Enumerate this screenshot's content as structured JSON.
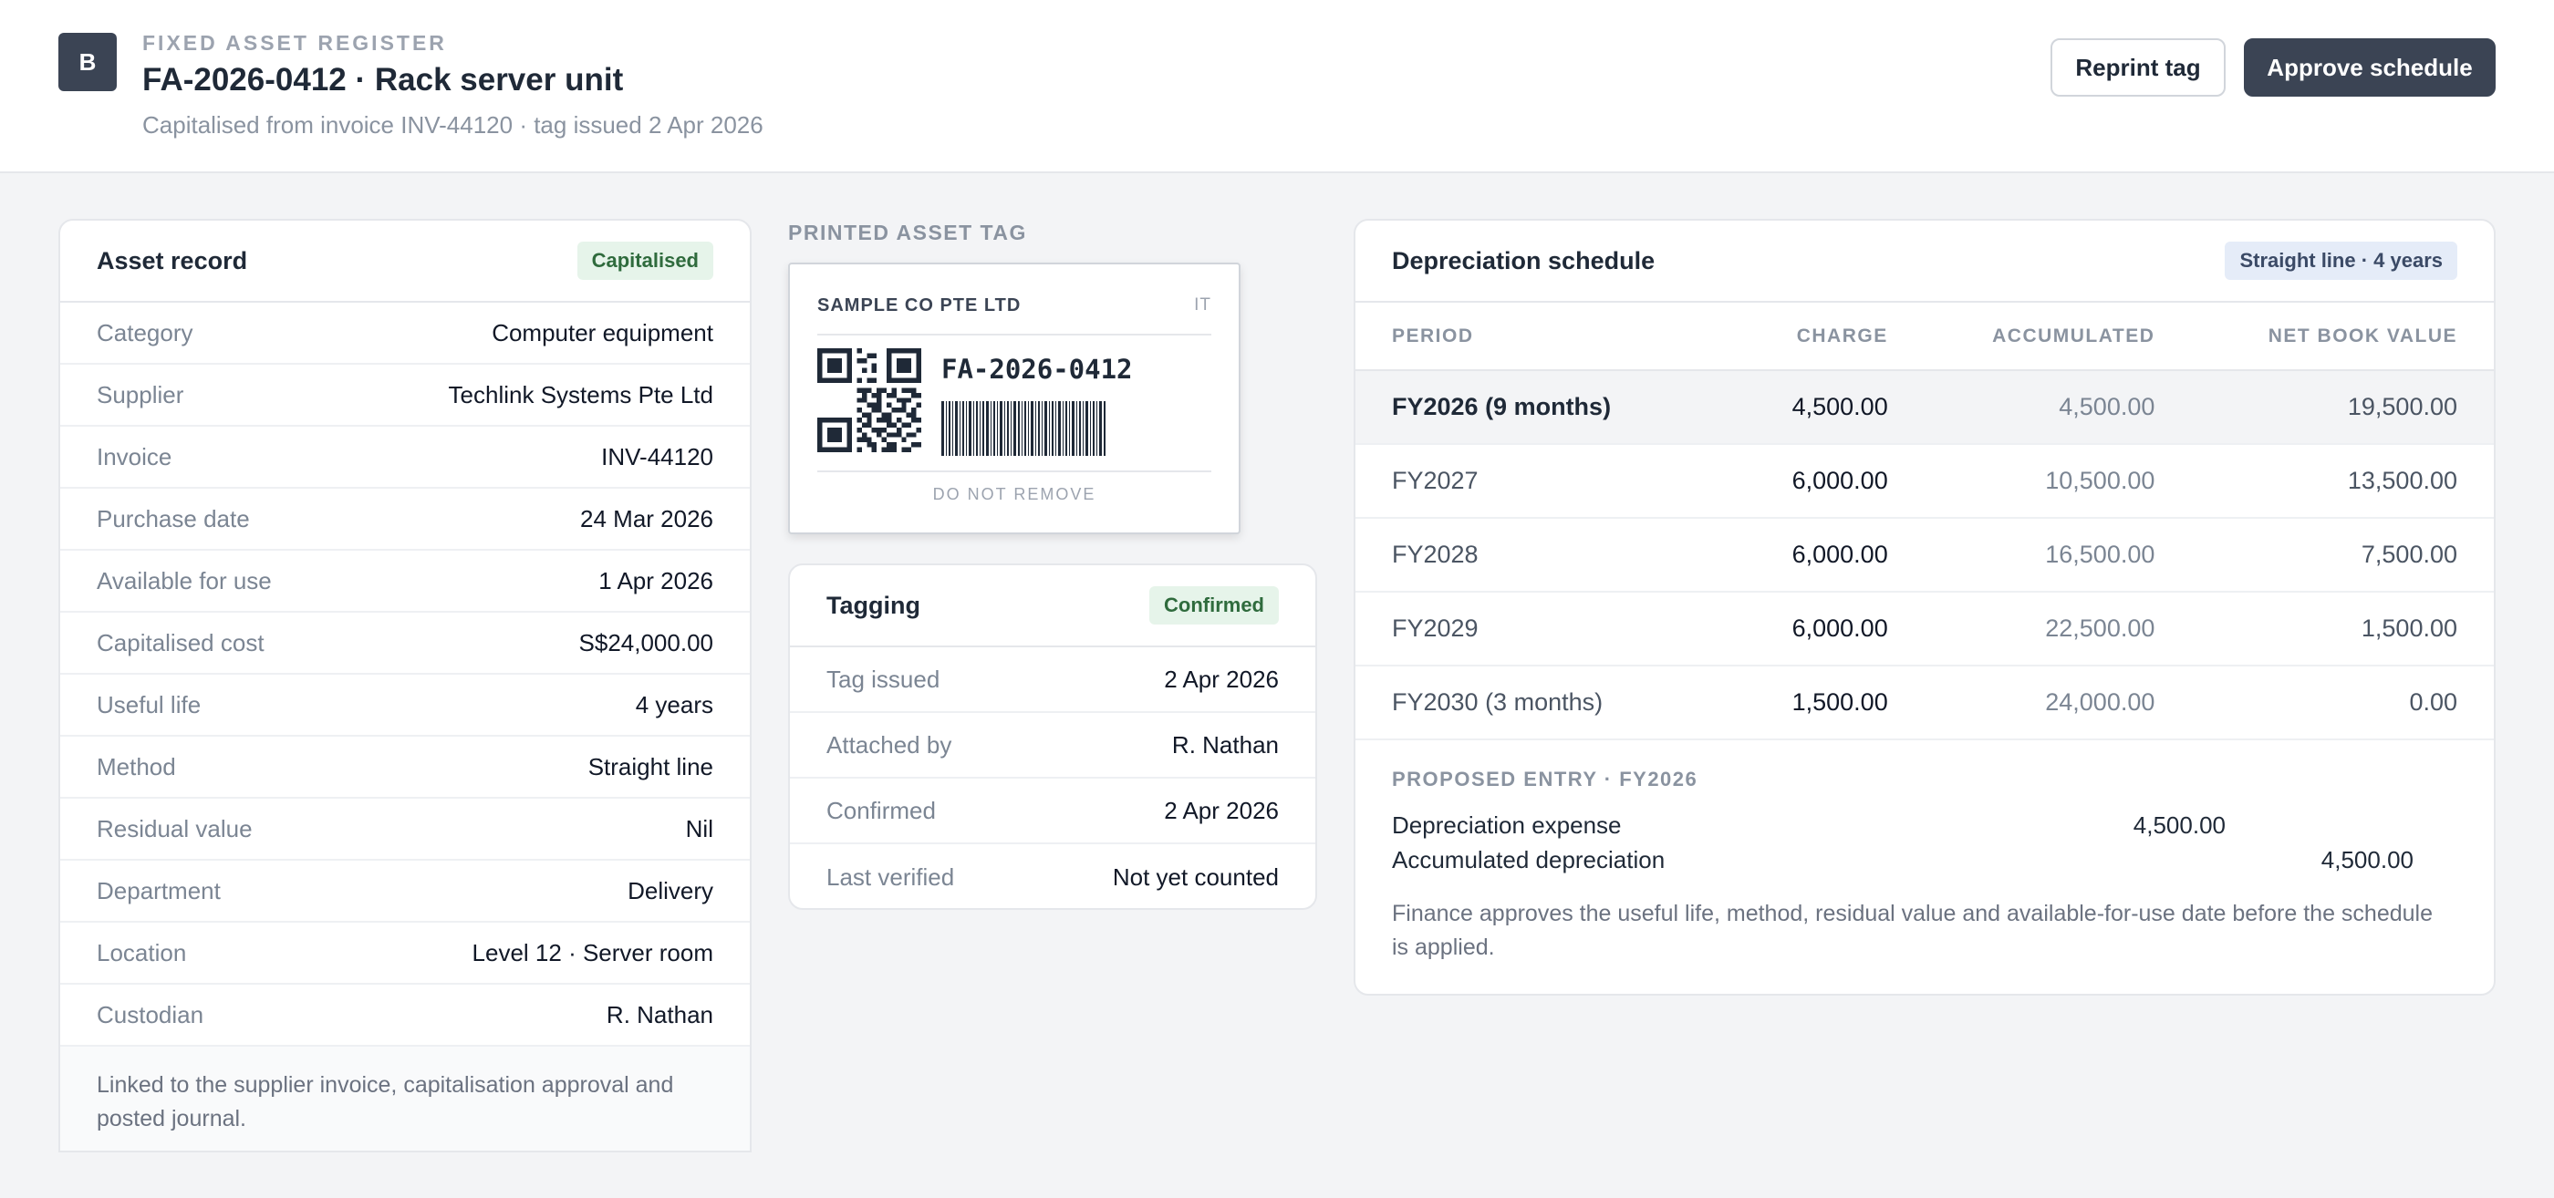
{
  "header": {
    "logo_letter": "B",
    "eyebrow": "FIXED ASSET REGISTER",
    "title": "FA-2026-0412 · Rack server unit",
    "subtitle": "Capitalised from invoice INV-44120 · tag issued 2 Apr 2026",
    "reprint_label": "Reprint tag",
    "approve_label": "Approve schedule"
  },
  "asset_record": {
    "title": "Asset record",
    "status": "Capitalised",
    "rows": [
      {
        "key": "Category",
        "value": "Computer equipment"
      },
      {
        "key": "Supplier",
        "value": "Techlink Systems Pte Ltd"
      },
      {
        "key": "Invoice",
        "value": "INV-44120"
      },
      {
        "key": "Purchase date",
        "value": "24 Mar 2026"
      },
      {
        "key": "Available for use",
        "value": "1 Apr 2026"
      },
      {
        "key": "Capitalised cost",
        "value": "S$24,000.00"
      },
      {
        "key": "Useful life",
        "value": "4 years"
      },
      {
        "key": "Method",
        "value": "Straight line"
      },
      {
        "key": "Residual value",
        "value": "Nil"
      },
      {
        "key": "Department",
        "value": "Delivery"
      },
      {
        "key": "Location",
        "value": "Level 12 · Server room"
      },
      {
        "key": "Custodian",
        "value": "R. Nathan"
      }
    ],
    "footnote": "Linked to the supplier invoice, capitalisation approval and posted journal."
  },
  "printed_tag": {
    "section_label": "PRINTED ASSET TAG",
    "company": "SAMPLE CO PTE LTD",
    "code": "IT",
    "asset_number": "FA-2026-0412",
    "footer": "DO NOT REMOVE"
  },
  "tagging": {
    "title": "Tagging",
    "status": "Confirmed",
    "rows": [
      {
        "key": "Tag issued",
        "value": "2 Apr 2026"
      },
      {
        "key": "Attached by",
        "value": "R. Nathan"
      },
      {
        "key": "Confirmed",
        "value": "2 Apr 2026"
      },
      {
        "key": "Last verified",
        "value": "Not yet counted"
      }
    ]
  },
  "depreciation": {
    "title": "Depreciation schedule",
    "method_badge": "Straight line · 4 years",
    "columns": [
      "PERIOD",
      "CHARGE",
      "ACCUMULATED",
      "NET BOOK VALUE"
    ],
    "rows": [
      {
        "period": "FY2026 (9 months)",
        "charge": "4,500.00",
        "accumulated": "4,500.00",
        "nbv": "19,500.00"
      },
      {
        "period": "FY2027",
        "charge": "6,000.00",
        "accumulated": "10,500.00",
        "nbv": "13,500.00"
      },
      {
        "period": "FY2028",
        "charge": "6,000.00",
        "accumulated": "16,500.00",
        "nbv": "7,500.00"
      },
      {
        "period": "FY2029",
        "charge": "6,000.00",
        "accumulated": "22,500.00",
        "nbv": "1,500.00"
      },
      {
        "period": "FY2030 (3 months)",
        "charge": "1,500.00",
        "accumulated": "24,000.00",
        "nbv": "0.00"
      }
    ],
    "entry_label": "PROPOSED ENTRY · FY2026",
    "entry": [
      {
        "account": "Depreciation expense",
        "debit": "4,500.00",
        "credit": ""
      },
      {
        "account": "Accumulated depreciation",
        "debit": "",
        "credit": "4,500.00"
      }
    ],
    "note": "Finance approves the useful life, method, residual value and available-for-use date before the schedule is applied."
  }
}
